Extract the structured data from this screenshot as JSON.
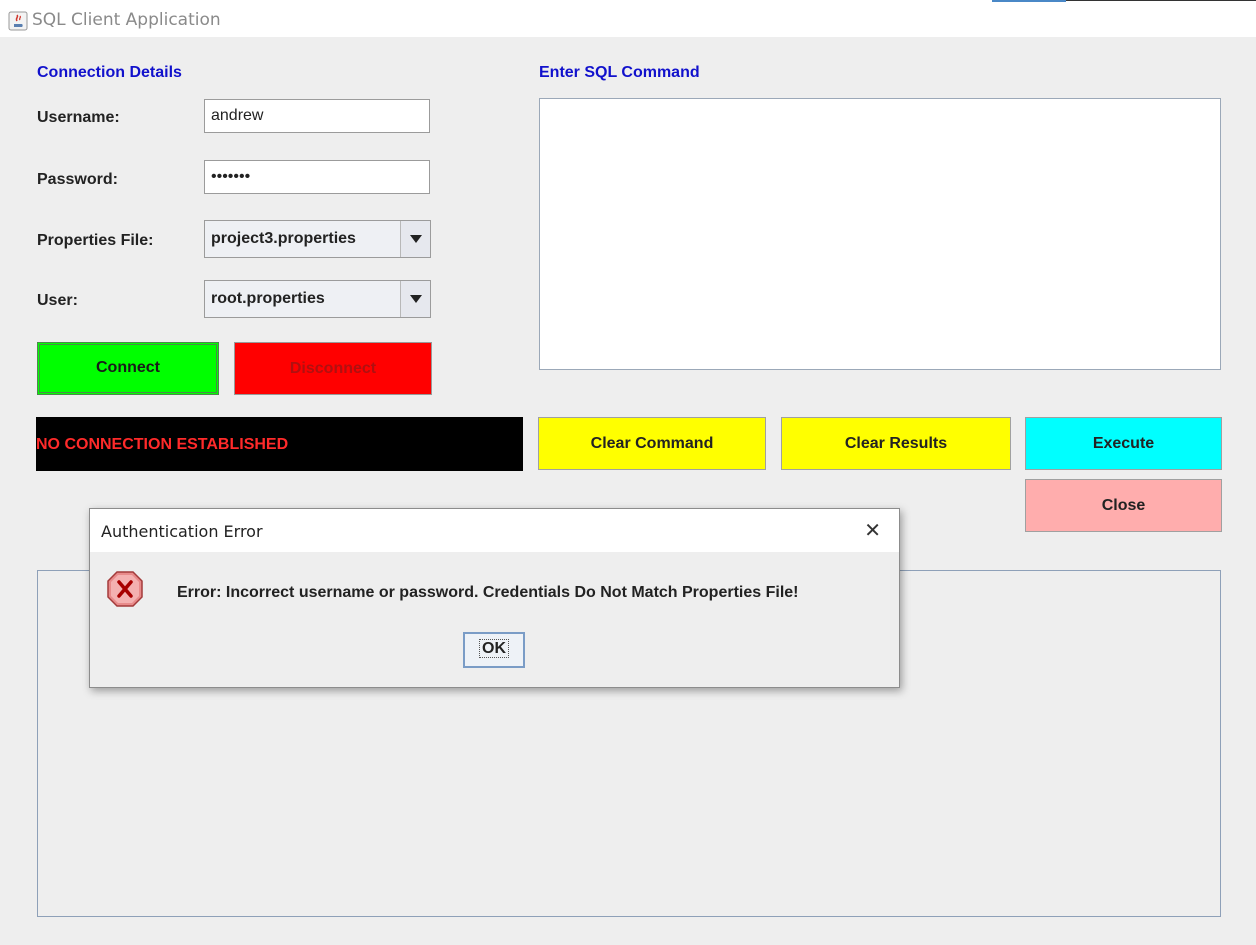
{
  "window": {
    "title": "SQL Client Application"
  },
  "connection": {
    "section_title": "Connection Details",
    "username_label": "Username:",
    "username_value": "andrew",
    "password_label": "Password:",
    "password_value": "•••••••",
    "properties_label": "Properties File:",
    "properties_value": "project3.properties",
    "user_label": "User:",
    "user_value": "root.properties",
    "connect_label": "Connect",
    "disconnect_label": "Disconnect",
    "status_text": "NO CONNECTION ESTABLISHED"
  },
  "sql": {
    "section_title": "Enter SQL Command",
    "command_text": "",
    "clear_command_label": "Clear Command",
    "clear_results_label": "Clear Results",
    "execute_label": "Execute",
    "close_label": "Close"
  },
  "dialog": {
    "title": "Authentication Error",
    "close_glyph": "✕",
    "message": "Error: Incorrect username or password. Credentials Do Not Match Properties File!",
    "ok_label": "OK"
  },
  "colors": {
    "section_title": "#1111cc",
    "connect": "#00ff00",
    "disconnect": "#ff0000",
    "status_bg": "#000000",
    "status_text": "#ff2a2a",
    "clear_buttons": "#ffff00",
    "execute": "#00ffff",
    "close": "#ffadad"
  },
  "icons": {
    "app": "java-icon",
    "dialog": "error-icon"
  }
}
